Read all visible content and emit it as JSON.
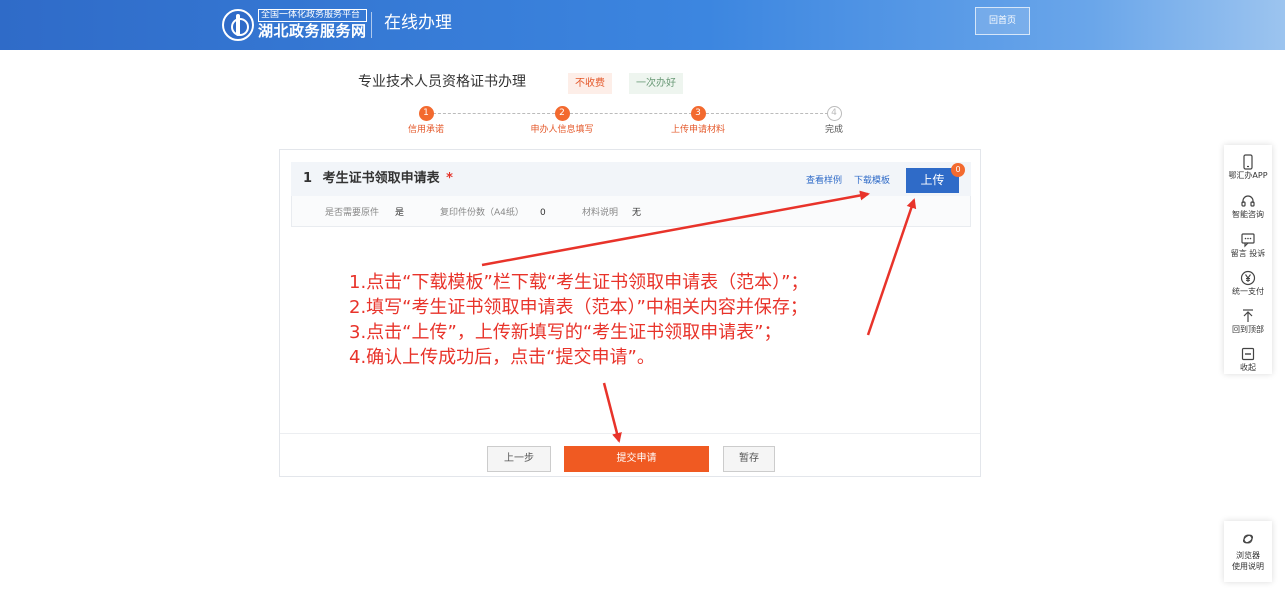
{
  "header": {
    "logo_tagline": "全国一体化政务服务平台",
    "logo_name": "湖北政务服务网",
    "title": "在线办理",
    "home_button": "回首页"
  },
  "service": {
    "title": "专业技术人员资格证书办理",
    "tags": [
      "不收费",
      "一次办好"
    ]
  },
  "steps": [
    {
      "number": "1",
      "label": "信用承诺",
      "state": "done"
    },
    {
      "number": "2",
      "label": "申办人信息填写",
      "state": "done"
    },
    {
      "number": "3",
      "label": "上传申请材料",
      "state": "current"
    },
    {
      "number": "4",
      "label": "完成",
      "state": "pending"
    }
  ],
  "document": {
    "index": "1",
    "title": "考生证书领取申请表",
    "required_mark": "*",
    "view_example": "查看样例",
    "download_template": "下载模板",
    "upload_button": "上传",
    "upload_count": "0",
    "info": [
      {
        "label": "是否需要原件",
        "value": "是"
      },
      {
        "label": "复印件份数（A4纸）",
        "value": "0"
      },
      {
        "label": "材料说明",
        "value": "无"
      }
    ]
  },
  "instructions": [
    "1.点击“下载模板”栏下载“考生证书领取申请表（范本）”；",
    "2.填写“考生证书领取申请表（范本）”中相关内容并保存；",
    "3.点击“上传”，上传新填写的“考生证书领取申请表”；",
    "4.确认上传成功后，点击“提交申请”。"
  ],
  "footer": {
    "prev": "上一步",
    "submit": "提交申请",
    "save": "暂存"
  },
  "toolbar": {
    "items": [
      {
        "label": "鄂汇办APP",
        "icon": "phone-icon"
      },
      {
        "label": "智能咨询",
        "icon": "headset-icon"
      },
      {
        "label": "留言 投诉",
        "icon": "message-icon"
      },
      {
        "label": "统一支付",
        "icon": "yuan-icon"
      },
      {
        "label": "回到顶部",
        "icon": "back-to-top-icon"
      },
      {
        "label": "收起",
        "icon": "collapse-icon"
      }
    ],
    "browser_line1": "浏览器",
    "browser_line2": "使用说明"
  },
  "colors": {
    "brand_blue": "#2f6bc8",
    "accent_orange": "#f05a22",
    "annotation_red": "#e8332a"
  }
}
